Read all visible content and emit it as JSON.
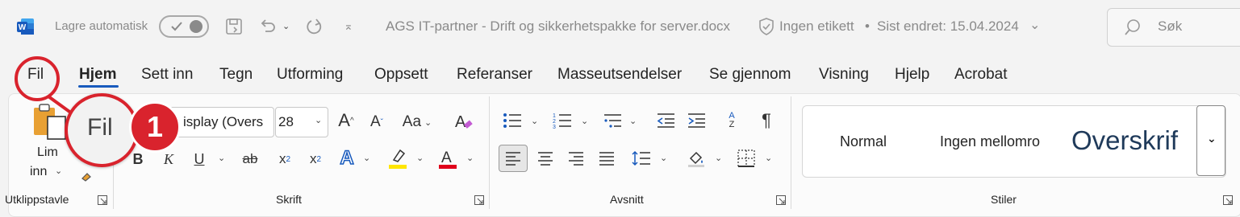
{
  "titlebar": {
    "app_icon": "word-logo-icon",
    "app_letter": "W",
    "autosave_label": "Lagre automatisk",
    "doc_title": "AGS IT-partner - Drift og sikkerhetspakke for server.docx",
    "label_status": "Ingen etikett",
    "dot": "•",
    "last_modified": "Sist endret: 15.04.2024",
    "search_placeholder": "Søk"
  },
  "tabs": [
    "Fil",
    "Hjem",
    "Sett inn",
    "Tegn",
    "Utforming",
    "Oppsett",
    "Referanser",
    "Masseutsendelser",
    "Se gjennom",
    "Visning",
    "Hjelp",
    "Acrobat"
  ],
  "active_tab": "Hjem",
  "clipboard": {
    "paste_line1": "Lim",
    "paste_line2": "inn",
    "group": "Utklippstavle"
  },
  "font": {
    "name": "isplay (Overs",
    "size": "28",
    "case_label": "Aa",
    "group": "Skrift"
  },
  "paragraph": {
    "group": "Avsnitt"
  },
  "styles": {
    "items": [
      "Normal",
      "Ingen mellomro",
      "Overskrif"
    ],
    "group": "Stiler"
  },
  "callout": {
    "magnified_label": "Fil",
    "step_number": "1",
    "ring_color": "#d9232d"
  },
  "colors": {
    "accent": "#185abd",
    "highlight": "#ffe600",
    "font_color": "#e0001b",
    "heading": "#1f3a5a"
  }
}
